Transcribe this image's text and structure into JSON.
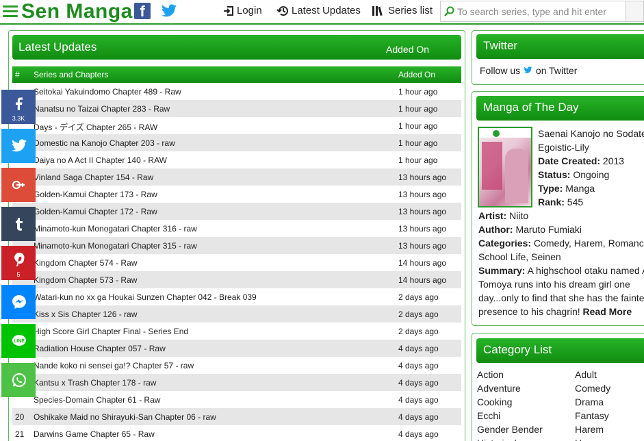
{
  "header": {
    "logo": "Sen Manga",
    "facebook_glyph": "f",
    "nav": [
      {
        "label": "Login",
        "icon": "login-icon"
      },
      {
        "label": "Latest Updates",
        "icon": "history-icon"
      },
      {
        "label": "Series list",
        "icon": "library-icon"
      }
    ],
    "search_placeholder": "To search series, type and hit enter"
  },
  "latest": {
    "title": "Latest Updates",
    "added_on": "Added On",
    "col_num": "#",
    "col_series": "Series and Chapters",
    "col_added": "Added On",
    "rows": [
      {
        "n": "",
        "title": "Seitokai Yakuindomo Chapter 489 - Raw",
        "added": "1 hour ago"
      },
      {
        "n": "",
        "title": "Nanatsu no Taizai Chapter 283 - Raw",
        "added": "1 hour ago"
      },
      {
        "n": "",
        "title": "Days - デイズ Chapter 265 - RAW",
        "added": "1 hour ago"
      },
      {
        "n": "",
        "title": "Domestic na Kanojo Chapter 203 - raw",
        "added": "1 hour ago"
      },
      {
        "n": "",
        "title": "Daiya no A Act II Chapter 140 - RAW",
        "added": "1 hour ago"
      },
      {
        "n": "",
        "title": "Vinland Saga Chapter 154 - Raw",
        "added": "13 hours ago"
      },
      {
        "n": "",
        "title": "Golden-Kamui Chapter 173 - Raw",
        "added": "13 hours ago"
      },
      {
        "n": "",
        "title": "Golden-Kamui Chapter 172 - Raw",
        "added": "13 hours ago"
      },
      {
        "n": "",
        "title": "Minamoto-kun Monogatari Chapter 316 - raw",
        "added": "13 hours ago"
      },
      {
        "n": "",
        "title": "Minamoto-kun Monogatari Chapter 315 - raw",
        "added": "13 hours ago"
      },
      {
        "n": "",
        "title": "Kingdom Chapter 574 - Raw",
        "added": "14 hours ago"
      },
      {
        "n": "",
        "title": "Kingdom Chapter 573 - Raw",
        "added": "14 hours ago"
      },
      {
        "n": "",
        "title": "Watari-kun no xx ga Houkai Sunzen Chapter 042 - Break 039",
        "added": "2 days ago"
      },
      {
        "n": "",
        "title": "Kiss x Sis Chapter 126 - raw",
        "added": "2 days ago"
      },
      {
        "n": "",
        "title": "High Score Girl Chapter Final - Series End",
        "added": "2 days ago"
      },
      {
        "n": "",
        "title": "Radiation House Chapter 057 - Raw",
        "added": "4 days ago"
      },
      {
        "n": "",
        "title": "Nande koko ni sensei ga!? Chapter 57 - raw",
        "added": "4 days ago"
      },
      {
        "n": "",
        "title": "Kantsu x Trash Chapter 178 - raw",
        "added": "4 days ago"
      },
      {
        "n": "",
        "title": "Species-Domain Chapter 61 - Raw",
        "added": "4 days ago"
      },
      {
        "n": "20",
        "title": "Oshikake Maid no Shirayuki-San Chapter 06 - raw",
        "added": "4 days ago"
      },
      {
        "n": "21",
        "title": "Darwins Game Chapter 65 - Raw",
        "added": "4 days ago"
      }
    ]
  },
  "share": [
    {
      "name": "facebook",
      "color": "#3b5998",
      "count": "3.3K"
    },
    {
      "name": "twitter",
      "color": "#1da1f2",
      "count": ""
    },
    {
      "name": "google-plus",
      "color": "#dd4b39",
      "count": ""
    },
    {
      "name": "tumblr",
      "color": "#35465c",
      "count": ""
    },
    {
      "name": "pinterest",
      "color": "#cb2027",
      "count": "5"
    },
    {
      "name": "messenger",
      "color": "#0084ff",
      "count": ""
    },
    {
      "name": "line",
      "color": "#00c300",
      "count": ""
    },
    {
      "name": "whatsapp",
      "color": "#4dc247",
      "count": ""
    }
  ],
  "twitter": {
    "title": "Twitter",
    "follow_prefix": "Follow us",
    "follow_suffix": "on Twitter"
  },
  "motd": {
    "title": "Manga of The Day",
    "name": "Saenai Kanojo no Sodatekata",
    "subname": "Egoistic-Lily",
    "date_label": "Date Created:",
    "date": "2013",
    "status_label": "Status:",
    "status": "Ongoing",
    "type_label": "Type:",
    "type": "Manga",
    "rank_label": "Rank:",
    "rank": "545",
    "artist_label": "Artist:",
    "artist": "Niito",
    "author_label": "Author:",
    "author": "Maruto Fumiaki",
    "categories_label": "Categories:",
    "categories_1": "Comedy, Harem, Romance,",
    "categories_2": "School Life, Seinen",
    "summary_label": "Summary:",
    "summary_1": "A highschool otaku named Aki",
    "summary_2": "Tomoya runs into his dream girl one",
    "summary_3": "day...only to find that she has the faintest",
    "summary_4_pre": "presence to his chagrin!",
    "read_more": "Read More"
  },
  "categories": {
    "title": "Category List",
    "left": [
      "Action",
      "Adventure",
      "Cooking",
      "Ecchi",
      "Gender Bender",
      "Historical"
    ],
    "right": [
      "Adult",
      "Comedy",
      "Drama",
      "Fantasy",
      "Harem",
      "Horror"
    ]
  },
  "colors": {
    "brand": "#1e8c1e",
    "header_green": "#118c11",
    "row_alt": "#e6e6e6"
  }
}
